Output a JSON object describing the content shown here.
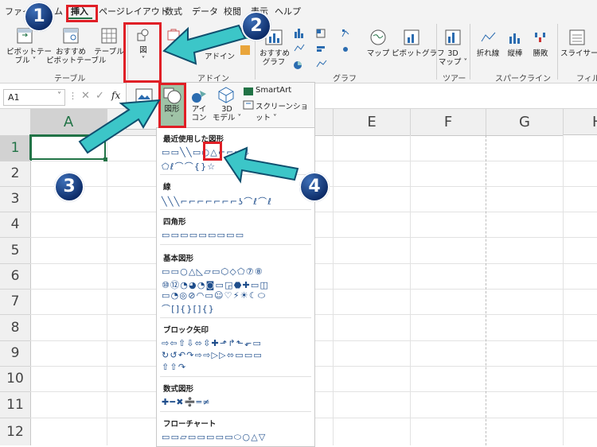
{
  "tabs": [
    "ファイ",
    "ム",
    "挿入",
    "ページレイアウト",
    "数式",
    "データ",
    "校閲",
    "表示",
    "ヘルプ"
  ],
  "ribbon": {
    "group_table": "テーブル",
    "group_addin": "アドイン",
    "group_chart": "グラフ",
    "group_tour": "ツアー",
    "group_sparkline": "スパークライン",
    "group_filter": "フィルタ",
    "btn_pivot": "ピボットテー\nブル ˅",
    "btn_rec_pivot": "おすすめ\nピボットテーブル",
    "btn_table": "テーブル",
    "btn_illust": "図",
    "btn_addin": "アドイン",
    "btn_rec_chart": "おすすめ\nグラフ",
    "btn_map": "マップ",
    "btn_pivot_chart": "ピボットグラフ",
    "btn_3dmap": "3D\nマップ ˅",
    "btn_line": "折れ線",
    "btn_column": "縦棒",
    "btn_winloss": "勝敗",
    "btn_slicer": "スライサー"
  },
  "formula_bar": {
    "namebox": "A1",
    "fx": "fx"
  },
  "columns": [
    "A",
    "B",
    "C",
    "D",
    "E",
    "F",
    "G",
    "H"
  ],
  "rows": [
    "1",
    "2",
    "3",
    "4",
    "5",
    "6",
    "7",
    "8",
    "9",
    "10",
    "11",
    "12"
  ],
  "insert_panel": {
    "image": "画像",
    "shapes": "図形",
    "icons": "アイ\nコン",
    "model3d": "3D\nモデル ˅",
    "smartart": "SmartArt",
    "screenshot": "スクリーンショット ˅"
  },
  "shapes_gallery": {
    "sections": [
      {
        "title": "最近使用した図形",
        "rows": [
          "▭▭╲╲▭○△⌐⌐⇨⇩",
          "⬠ℓ⌒⌒{}☆"
        ]
      },
      {
        "title": "線",
        "rows": [
          "╲╲╲⌐⌐⌐⌐⌐⌐⌐ʖ⌒ℓ⌒ℓ"
        ]
      },
      {
        "title": "四角形",
        "rows": [
          "▭▭▭▭▭▭▭▭▭"
        ]
      },
      {
        "title": "基本図形",
        "rows": [
          "▭▭○△◺▱▭⬡◇⬠⑦⑧",
          "⑩⑫◔◕◔◙▭◲⬣✚▭◫",
          "▭◔◎⊘◠▭☺♡⚡☀☾⬭",
          "⌒[]{}[]{}"
        ]
      },
      {
        "title": "ブロック矢印",
        "rows": [
          "⇨⇦⇧⇩⬄⇳✚⬏↱⬑⬐▭",
          "↻↺↶↷⇨⇨▷▷⬄▭▭▭",
          "⇧⇧↷"
        ]
      },
      {
        "title": "数式図形",
        "rows": [
          "✚━✖➗═≠"
        ]
      },
      {
        "title": "フローチャート",
        "rows": [
          "▭▭▱▭▭▭▭▭⬭○△▽"
        ]
      }
    ]
  },
  "badges": [
    "1",
    "2",
    "3",
    "4"
  ],
  "colors": {
    "accent_red": "#e01f26",
    "badge_blue": "#0b2a66",
    "arrow_teal": "#3cc6c8",
    "excel_green": "#217346"
  }
}
